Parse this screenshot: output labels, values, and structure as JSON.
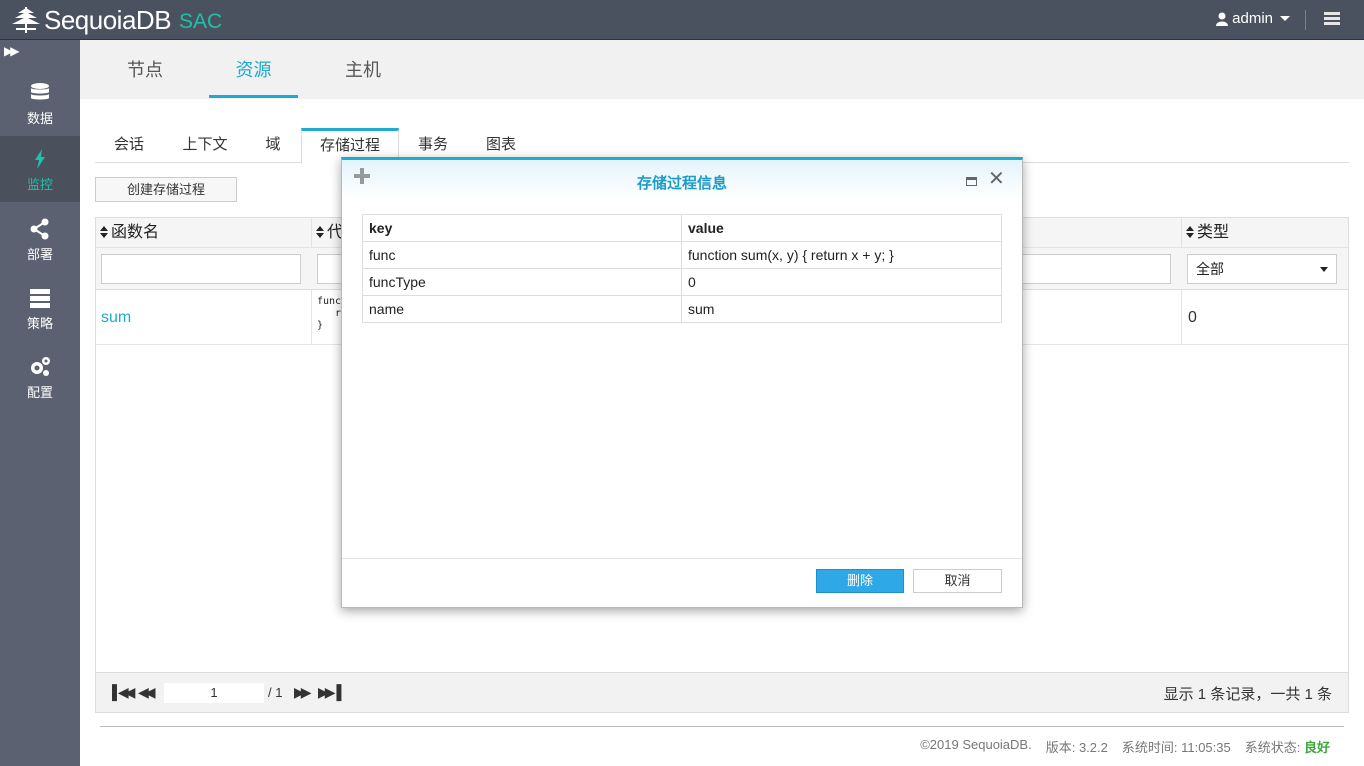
{
  "header": {
    "brand": "SequoiaDB",
    "product": "SAC",
    "user": "admin"
  },
  "sidebar": {
    "items": [
      {
        "label": "数据",
        "icon": "database-icon"
      },
      {
        "label": "监控",
        "icon": "lightning-icon"
      },
      {
        "label": "部署",
        "icon": "share-icon"
      },
      {
        "label": "策略",
        "icon": "server-icon"
      },
      {
        "label": "配置",
        "icon": "gears-icon"
      }
    ],
    "active": "监控"
  },
  "page_tabs": [
    "节点",
    "资源",
    "主机"
  ],
  "active_page_tab": "资源",
  "sub_tabs": [
    "会话",
    "上下文",
    "域",
    "存储过程",
    "事务",
    "图表"
  ],
  "active_sub_tab": "存储过程",
  "create_button": "创建存储过程",
  "table": {
    "columns": [
      "函数名",
      "代",
      "类型"
    ],
    "type_filter": "全部",
    "rows": [
      {
        "name": "sum",
        "code": "func\n   r\n}",
        "type": "0"
      }
    ]
  },
  "pagination": {
    "page": "1",
    "total": "/ 1",
    "info": "显示 1 条记录，一共 1 条"
  },
  "footer": {
    "copyright": "©2019 SequoiaDB.",
    "version": "版本: 3.2.2",
    "time": "系统时间: 11:05:35",
    "status_label": "系统状态:",
    "status_value": "良好"
  },
  "modal": {
    "title": "存储过程信息",
    "headers": [
      "key",
      "value"
    ],
    "rows": [
      [
        "func",
        "function sum(x, y) { return x + y; }"
      ],
      [
        "funcType",
        "0"
      ],
      [
        "name",
        "sum"
      ]
    ],
    "delete_label": "删除",
    "cancel_label": "取消"
  },
  "colors": {
    "accent": "#1eaad1",
    "brand_green": "#1fc1a8",
    "sidebar_bg": "#5b6170",
    "topbar_bg": "#4a5260",
    "status_good": "#3aa93a"
  }
}
